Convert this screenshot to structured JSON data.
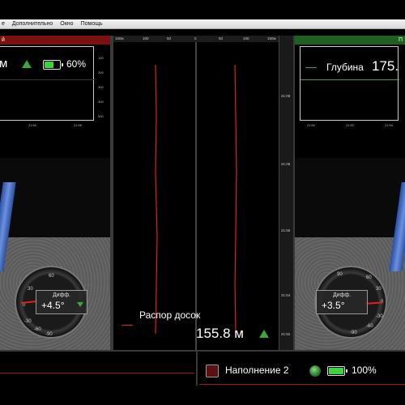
{
  "menu": {
    "items": [
      "е",
      "Дополнительно",
      "Окно",
      "Помощь"
    ]
  },
  "left_panel": {
    "header": "й",
    "unit": "м",
    "battery_percent": "60%",
    "battery_level": 0.6,
    "y_ticks": [
      "100",
      "200",
      "300",
      "400",
      "500"
    ],
    "x_ticks": [
      "21:50",
      "21:55"
    ],
    "gauge": {
      "title": "Дифф.",
      "value": "+4.5°",
      "marks": [
        "60",
        "30",
        "0",
        "-30",
        "-60",
        "-90",
        "90"
      ]
    }
  },
  "right_panel": {
    "header": "П",
    "depth_label": "Глубина",
    "depth_value": "175.",
    "x_ticks": [
      "21:50",
      "21:52",
      "21:54"
    ],
    "gauge": {
      "title": "Дифф.",
      "value": "+3.5°",
      "marks": [
        "90",
        "60",
        "30",
        "0",
        "-30",
        "-60",
        "-90"
      ]
    }
  },
  "center_panel": {
    "top_ticks": [
      "150м",
      "100",
      "50",
      "0",
      "50",
      "100",
      "150м"
    ],
    "right_ticks": [
      "21:08",
      "21:06",
      "21:56",
      "21:54",
      "21:52"
    ],
    "legend_label": "Распор досок",
    "value": "155.8 м"
  },
  "bottom": {
    "fill_label": "Наполнение 2",
    "battery_percent": "100%",
    "battery_level": 1.0
  },
  "colors": {
    "accent_green": "#3da53d",
    "alert_red": "#e02020",
    "header_red": "#7a1010",
    "header_green": "#1f5f1f"
  }
}
